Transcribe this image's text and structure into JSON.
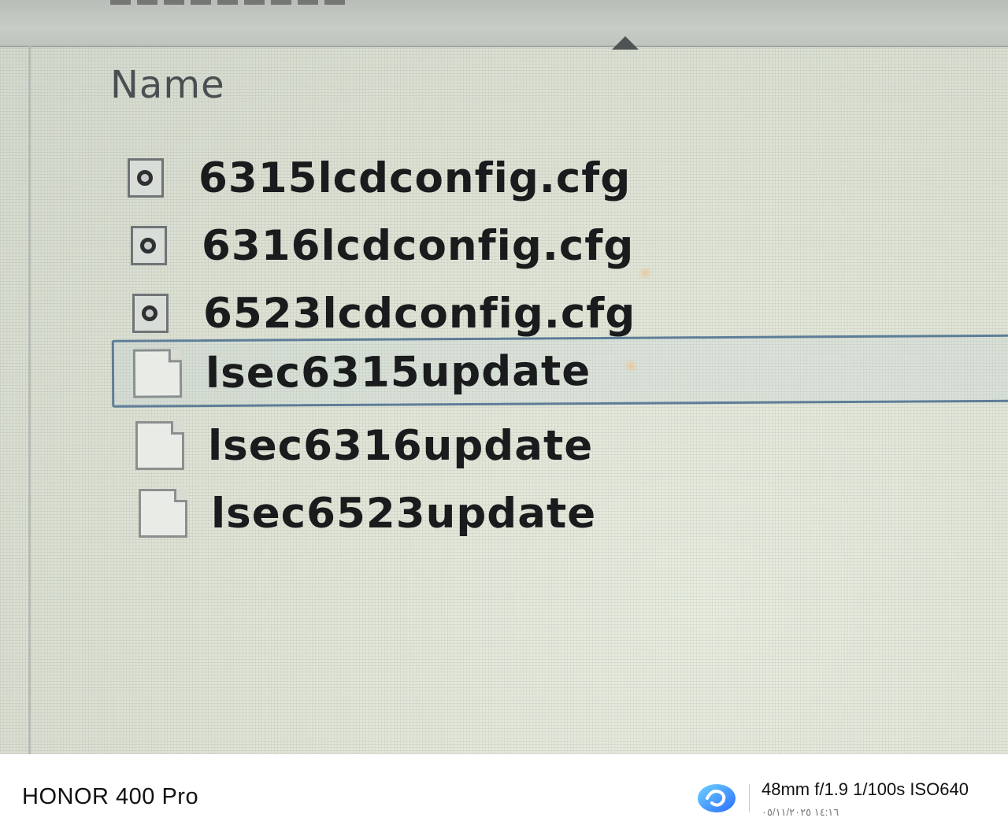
{
  "explorer": {
    "column_header": "Name",
    "sort_indicator_icon": "sort-ascending-icon",
    "files": [
      {
        "name": "6315lcdconfig.cfg",
        "icon": "config-file-icon",
        "selected": false
      },
      {
        "name": "6316lcdconfig.cfg",
        "icon": "config-file-icon",
        "selected": false
      },
      {
        "name": "6523lcdconfig.cfg",
        "icon": "config-file-icon",
        "selected": false
      },
      {
        "name": "lsec6315update",
        "icon": "blank-file-icon",
        "selected": true
      },
      {
        "name": "lsec6316update",
        "icon": "blank-file-icon",
        "selected": false
      },
      {
        "name": "lsec6523update",
        "icon": "blank-file-icon",
        "selected": false
      }
    ],
    "selection_color": "#5e7d97"
  },
  "watermark": {
    "device": "HONOR 400 Pro",
    "exif": "48mm  f/1.9  1/100s  ISO640",
    "datetime": "١٤:١٦ ٠٥/١١/٢٠٢٥",
    "logo_icon": "honor-ai-logo-icon"
  }
}
